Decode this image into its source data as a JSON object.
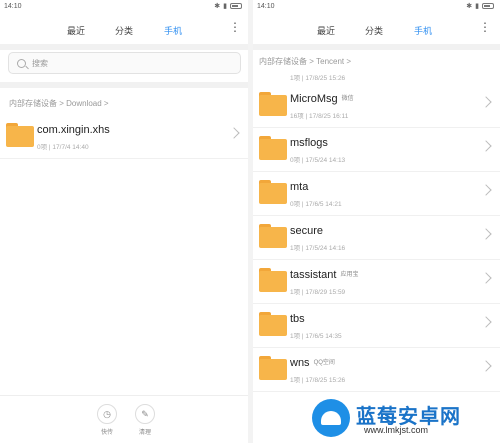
{
  "left": {
    "status": {
      "time": "14:10"
    },
    "tabs": [
      "最近",
      "分类",
      "手机"
    ],
    "active_tab": "手机",
    "search_placeholder": "搜索",
    "breadcrumb": "内部存储设备 > Download >",
    "items": [
      {
        "name": "com.xingin.xhs",
        "meta": "0项 | 17/7/4 14:40"
      }
    ],
    "actions": [
      {
        "icon": "clock-icon",
        "label": "快传"
      },
      {
        "icon": "broom-icon",
        "label": "清理"
      }
    ]
  },
  "right": {
    "status": {
      "time": "14:10"
    },
    "tabs": [
      "最近",
      "分类",
      "手机"
    ],
    "active_tab": "手机",
    "breadcrumb": "内部存储设备 > Tencent >",
    "partial_meta": "1项 | 17/8/25 15:26",
    "items": [
      {
        "name": "MicroMsg",
        "tag": "微信",
        "meta": "16项 | 17/8/25 16:11"
      },
      {
        "name": "msflogs",
        "tag": "",
        "meta": "0项 | 17/5/24 14:13"
      },
      {
        "name": "mta",
        "tag": "",
        "meta": "0项 | 17/6/5 14:21"
      },
      {
        "name": "secure",
        "tag": "",
        "meta": "1项 | 17/5/24 14:16"
      },
      {
        "name": "tassistant",
        "tag": "应用宝",
        "meta": "1项 | 17/8/29 15:59"
      },
      {
        "name": "tbs",
        "tag": "",
        "meta": "1项 | 17/6/5 14:35"
      },
      {
        "name": "wns",
        "tag": "QQ空间",
        "meta": "1项 | 17/8/25 15:26"
      }
    ]
  },
  "watermark": {
    "title": "蓝莓安卓网",
    "url": "www.lmkjst.com"
  }
}
